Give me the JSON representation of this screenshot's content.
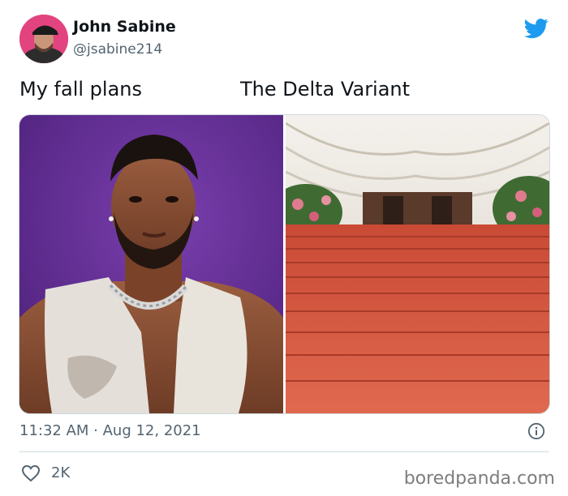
{
  "tweet": {
    "author_name": "John Sabine",
    "author_handle": "@jsabine214",
    "caption_left": "My fall plans",
    "caption_right": "The Delta Variant",
    "timestamp": "11:32 AM · Aug 12, 2021",
    "likes": "2K"
  },
  "watermark": "boredpanda.com",
  "icons": {
    "brand": "twitter-bird-icon",
    "info": "info-icon",
    "like": "heart-icon"
  },
  "colors": {
    "twitter_blue": "#1d9bf0",
    "muted_text": "#536471",
    "left_bg_purple": "#5b2a8a",
    "carpet_red": "#d9543e"
  }
}
